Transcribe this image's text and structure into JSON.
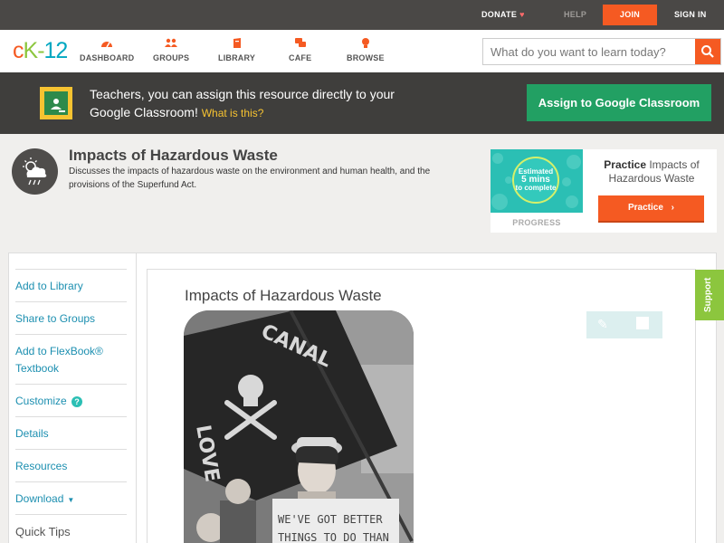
{
  "topbar": {
    "donate": "DONATE",
    "help": "HELP",
    "join": "JOIN",
    "signin": "SIGN IN"
  },
  "nav": {
    "logo": {
      "c": "c",
      "k": "K",
      "dash": "-",
      "n": "12"
    },
    "items": [
      {
        "label": "DASHBOARD",
        "icon": "dashboard-icon"
      },
      {
        "label": "GROUPS",
        "icon": "groups-icon"
      },
      {
        "label": "LIBRARY",
        "icon": "library-icon"
      },
      {
        "label": "CAFE",
        "icon": "cafe-icon"
      },
      {
        "label": "BROWSE",
        "icon": "browse-icon"
      }
    ],
    "search_placeholder": "What do you want to learn today?"
  },
  "banner": {
    "text": "Teachers, you can assign this resource directly to your Google Classroom!",
    "what": "What is this?",
    "button": "Assign to Google Classroom"
  },
  "header": {
    "title": "Impacts of Hazardous Waste",
    "description": "Discusses the impacts of hazardous waste on the environment and human health, and the provisions of the Superfund Act."
  },
  "practice": {
    "estimated_line1": "Estimated",
    "estimated_mins": "5 mins",
    "estimated_line3": "to complete",
    "progress_label": "PROGRESS",
    "title_bold": "Practice",
    "title_rest": "Impacts of Hazardous Waste",
    "button": "Practice"
  },
  "sidebar": {
    "items": [
      {
        "label": "Add to Library"
      },
      {
        "label": "Share to Groups"
      },
      {
        "label": "Add to FlexBook® Textbook"
      },
      {
        "label": "Customize",
        "badge": "?"
      },
      {
        "label": "Details"
      },
      {
        "label": "Resources"
      },
      {
        "label": "Download",
        "caret": "▼"
      },
      {
        "label": "Quick Tips"
      }
    ]
  },
  "content": {
    "title": "Impacts of Hazardous Waste",
    "photo_text": {
      "flag": "CANAL",
      "flag2": "LOVE",
      "sign1": "WE'VE GOT BETTER",
      "sign2": "THINGS TO DO THAN"
    }
  },
  "support": "Support",
  "colors": {
    "accent": "#f55a22",
    "link": "#1c8fb0",
    "green": "#22a063",
    "teal": "#2bbfb4",
    "support": "#8cc63e"
  }
}
